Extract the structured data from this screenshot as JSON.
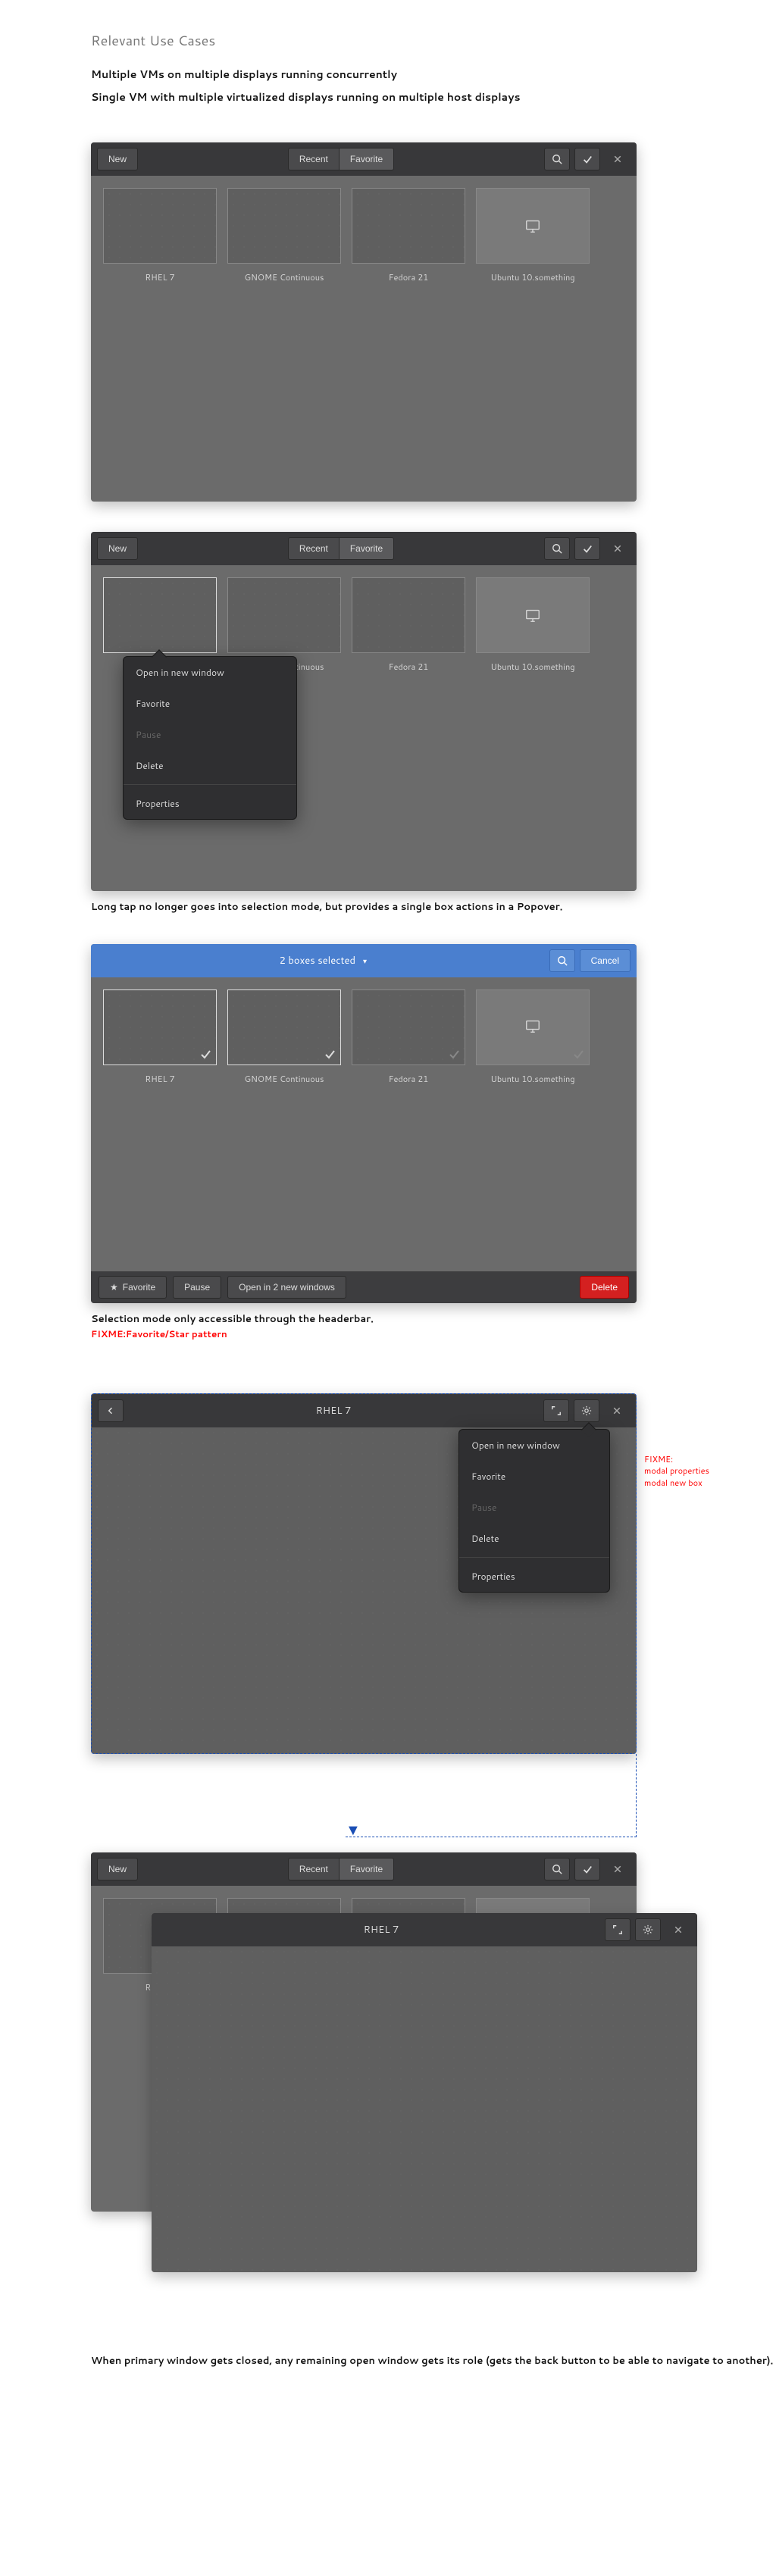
{
  "headings": {
    "relevant": "Relevant Use Cases"
  },
  "usecases": [
    "Multiple VMs on multiple displays running concurrently",
    "Single VM with multiple virtualized displays running on multiple host displays"
  ],
  "header": {
    "new": "New",
    "recent": "Recent",
    "favorite": "Favorite",
    "cancel": "Cancel"
  },
  "boxes": [
    {
      "label": "RHEL 7"
    },
    {
      "label": "GNOME Continuous"
    },
    {
      "label": "Fedora 21"
    },
    {
      "label": "Ubuntu 10.something"
    }
  ],
  "popover": {
    "open_new": "Open in new window",
    "favorite": "Favorite",
    "pause": "Pause",
    "delete": "Delete",
    "properties": "Properties"
  },
  "captions": {
    "longtap": "Long tap no longer goes into selection mode, but provides a single box actions in a Popover.",
    "selection_header": "Selection mode only accessible through the headerbar.",
    "fixme_star": "FIXME:Favorite/Star pattern",
    "fixme_modal": "FIXME:\nmodal properties\nmodal new box",
    "closed_role": "When primary window gets closed, any remaining open window gets its role (gets the back button to be able to navigate to another)."
  },
  "selection": {
    "title": "2 boxes selected"
  },
  "actionbar": {
    "favorite": "Favorite",
    "pause": "Pause",
    "open_n": "Open in 2 new windows",
    "delete": "Delete"
  },
  "detail": {
    "title": "RHEL 7"
  }
}
